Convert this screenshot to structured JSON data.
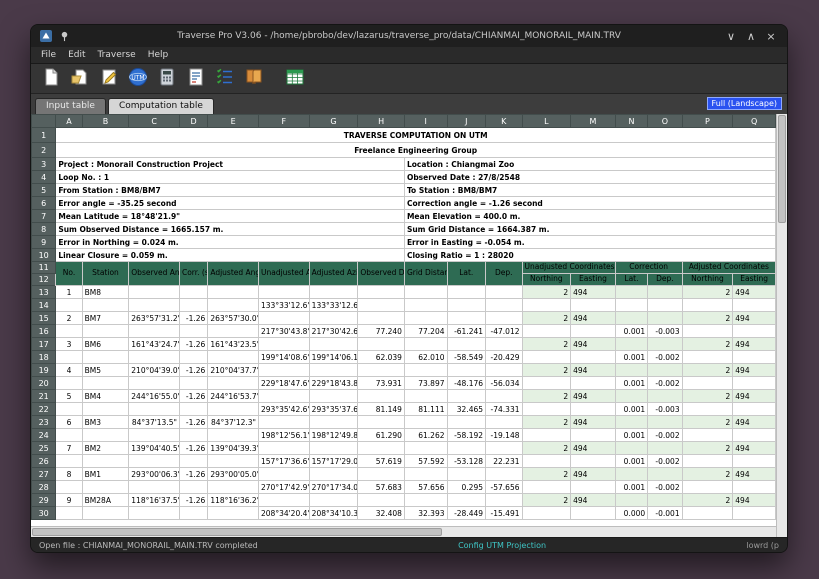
{
  "window": {
    "title": "Traverse Pro V3.06 - /home/pbrobo/dev/lazarus/traverse_pro/data/CHIANMAI_MONORAIL_MAIN.TRV",
    "controls": {
      "minimize": "∨",
      "maximize": "∧",
      "close": "×"
    }
  },
  "menu": [
    "File",
    "Edit",
    "Traverse",
    "Help"
  ],
  "toolbar_icons": [
    "new-file-icon",
    "open-file-icon",
    "edit-icon",
    "utm-globe-icon",
    "calculator-icon",
    "report-icon",
    "checklist-icon",
    "book-icon",
    "export-table-icon"
  ],
  "tabs": [
    {
      "label": "Input table",
      "active": false
    },
    {
      "label": "Computation table",
      "active": true
    }
  ],
  "view_badge": "Full (Landscape)",
  "colors": {
    "title": "#b400b4",
    "green": "#007a00",
    "red": "#cc0000",
    "blue": "#0000cc",
    "header_bg": "#2e6b53",
    "tint": "#e4f1e2",
    "badge": "#2a52f0"
  },
  "statusbar": {
    "left": "Open file : CHIANMAI_MONORAIL_MAIN.TRV completed",
    "center": "Config UTM Projection",
    "right": "lowrd (p"
  },
  "sheet": {
    "columns": [
      "A",
      "B",
      "C",
      "D",
      "E",
      "F",
      "G",
      "H",
      "I",
      "J",
      "K",
      "L",
      "M",
      "N",
      "O",
      "P",
      "Q"
    ],
    "title1": {
      "row": "1",
      "text": "TRAVERSE COMPUTATION ON UTM"
    },
    "title2": {
      "row": "2",
      "text": "Freelance Engineering Group"
    },
    "info_rows": [
      {
        "row": "3",
        "left": "Project : Monorail Construction Project",
        "right": "Location : Chiangmai Zoo",
        "left_color": "green",
        "right_color": "green"
      },
      {
        "row": "4",
        "left": "Loop No. : 1",
        "right": "Observed Date : 27/8/2548",
        "left_color": "green",
        "right_color": "green"
      },
      {
        "row": "5",
        "left": "From Station : BM8/BM7",
        "right": "To Station : BM8/BM7",
        "left_color": "green",
        "right_color": "green"
      },
      {
        "row": "6",
        "left": "Error angle = -35.25 second",
        "right": "Correction angle = -1.26 second",
        "left_color": "red",
        "right_color": "red"
      },
      {
        "row": "7",
        "left": "Mean Latitude = 18°48'21.9\"",
        "right": "Mean Elevation = 400.0 m.",
        "left_color": "blue",
        "right_color": "blue"
      },
      {
        "row": "8",
        "left": "Sum Observed Distance = 1665.157 m.",
        "right": "Sum Grid Distance = 1664.387 m.",
        "left_color": "blue",
        "right_color": "blue"
      },
      {
        "row": "9",
        "left": "Error in Northing = 0.024 m.",
        "right": "Error in Easting = -0.054 m.",
        "left_color": "red",
        "right_color": "red"
      },
      {
        "row": "10",
        "left": "Linear Closure = 0.059 m.",
        "right": "Closing Ratio = 1 :  28020",
        "left_color": "red",
        "right_color": "blue"
      }
    ],
    "header": {
      "row1": "11",
      "row2": "12",
      "no": "No.",
      "station": "Station",
      "observed_angle": "Observed Angle",
      "corr": "Corr. (sec.)",
      "adjusted_angle": "Adjusted Angle",
      "unadjusted_azimuth": "Unadjusted Azimuth",
      "adjusted_azimuth": "Adjusted Azimuth",
      "observed_distance": "Observed Distance",
      "grid_distance": "Grid Distance",
      "lat": "Lat.",
      "dep": "Dep.",
      "unadjusted_coordinates": "Unadjusted Coordinates",
      "correction": "Correction",
      "adjusted_coordinates": "Adjusted Coordinates",
      "northing": "Northing",
      "easting": "Easting"
    },
    "data_rows": [
      {
        "row": "13",
        "type": "station",
        "cells": [
          "1",
          "BM8",
          "",
          "",
          "",
          "",
          "",
          "",
          "",
          "",
          "",
          "2",
          "494",
          "",
          "",
          "2",
          "494"
        ]
      },
      {
        "row": "14",
        "type": "leg",
        "cells": [
          "",
          "",
          "",
          "",
          "",
          "133°33'12.6\"",
          "133°33'12.6\"",
          "",
          "",
          "",
          "",
          "",
          "",
          "",
          "",
          "",
          ""
        ]
      },
      {
        "row": "15",
        "type": "station",
        "cells": [
          "2",
          "BM7",
          "263°57'31.2\"",
          "-1.26",
          "263°57'30.0\"",
          "",
          "",
          "",
          "",
          "",
          "",
          "2",
          "494",
          "",
          "",
          "2",
          "494"
        ]
      },
      {
        "row": "16",
        "type": "leg",
        "cells": [
          "",
          "",
          "",
          "",
          "",
          "217°30'43.8\"",
          "217°30'42.6\"",
          "77.240",
          "77.204",
          "-61.241",
          "-47.012",
          "",
          "",
          "0.001",
          "-0.003",
          "",
          ""
        ]
      },
      {
        "row": "17",
        "type": "station",
        "cells": [
          "3",
          "BM6",
          "161°43'24.7\"",
          "-1.26",
          "161°43'23.5\"",
          "",
          "",
          "",
          "",
          "",
          "",
          "2",
          "494",
          "",
          "",
          "2",
          "494"
        ]
      },
      {
        "row": "18",
        "type": "leg",
        "cells": [
          "",
          "",
          "",
          "",
          "",
          "199°14'08.6\"",
          "199°14'06.1\"",
          "62.039",
          "62.010",
          "-58.549",
          "-20.429",
          "",
          "",
          "0.001",
          "-0.002",
          "",
          ""
        ]
      },
      {
        "row": "19",
        "type": "station",
        "cells": [
          "4",
          "BM5",
          "210°04'39.0\"",
          "-1.26",
          "210°04'37.7\"",
          "",
          "",
          "",
          "",
          "",
          "",
          "2",
          "494",
          "",
          "",
          "2",
          "494"
        ]
      },
      {
        "row": "20",
        "type": "leg",
        "cells": [
          "",
          "",
          "",
          "",
          "",
          "229°18'47.6\"",
          "229°18'43.8\"",
          "73.931",
          "73.897",
          "-48.176",
          "-56.034",
          "",
          "",
          "0.001",
          "-0.002",
          "",
          ""
        ]
      },
      {
        "row": "21",
        "type": "station",
        "cells": [
          "5",
          "BM4",
          "244°16'55.0\"",
          "-1.26",
          "244°16'53.7\"",
          "",
          "",
          "",
          "",
          "",
          "",
          "2",
          "494",
          "",
          "",
          "2",
          "494"
        ]
      },
      {
        "row": "22",
        "type": "leg",
        "cells": [
          "",
          "",
          "",
          "",
          "",
          "293°35'42.6\"",
          "293°35'37.6\"",
          "81.149",
          "81.111",
          "32.465",
          "-74.331",
          "",
          "",
          "0.001",
          "-0.003",
          "",
          ""
        ]
      },
      {
        "row": "23",
        "type": "station",
        "cells": [
          "6",
          "BM3",
          "84°37'13.5\"",
          "-1.26",
          "84°37'12.3\"",
          "",
          "",
          "",
          "",
          "",
          "",
          "2",
          "494",
          "",
          "",
          "2",
          "494"
        ]
      },
      {
        "row": "24",
        "type": "leg",
        "cells": [
          "",
          "",
          "",
          "",
          "",
          "198°12'56.1\"",
          "198°12'49.8\"",
          "61.290",
          "61.262",
          "-58.192",
          "-19.148",
          "",
          "",
          "0.001",
          "-0.002",
          "",
          ""
        ]
      },
      {
        "row": "25",
        "type": "station",
        "cells": [
          "7",
          "BM2",
          "139°04'40.5\"",
          "-1.26",
          "139°04'39.3\"",
          "",
          "",
          "",
          "",
          "",
          "",
          "2",
          "494",
          "",
          "",
          "2",
          "494"
        ]
      },
      {
        "row": "26",
        "type": "leg",
        "cells": [
          "",
          "",
          "",
          "",
          "",
          "157°17'36.6\"",
          "157°17'29.0\"",
          "57.619",
          "57.592",
          "-53.128",
          "22.231",
          "",
          "",
          "0.001",
          "-0.002",
          "",
          ""
        ]
      },
      {
        "row": "27",
        "type": "station",
        "cells": [
          "8",
          "BM1",
          "293°00'06.3\"",
          "-1.26",
          "293°00'05.0\"",
          "",
          "",
          "",
          "",
          "",
          "",
          "2",
          "494",
          "",
          "",
          "2",
          "494"
        ]
      },
      {
        "row": "28",
        "type": "leg",
        "cells": [
          "",
          "",
          "",
          "",
          "",
          "270°17'42.9\"",
          "270°17'34.0\"",
          "57.683",
          "57.656",
          "0.295",
          "-57.656",
          "",
          "",
          "0.001",
          "-0.002",
          "",
          ""
        ]
      },
      {
        "row": "29",
        "type": "station",
        "cells": [
          "9",
          "BM28A",
          "118°16'37.5\"",
          "-1.26",
          "118°16'36.2\"",
          "",
          "",
          "",
          "",
          "",
          "",
          "2",
          "494",
          "",
          "",
          "2",
          "494"
        ]
      },
      {
        "row": "30",
        "type": "leg",
        "cells": [
          "",
          "",
          "",
          "",
          "",
          "208°34'20.4\"",
          "208°34'10.3\"",
          "32.408",
          "32.393",
          "-28.449",
          "-15.491",
          "",
          "",
          "0.000",
          "-0.001",
          "",
          ""
        ]
      }
    ]
  }
}
